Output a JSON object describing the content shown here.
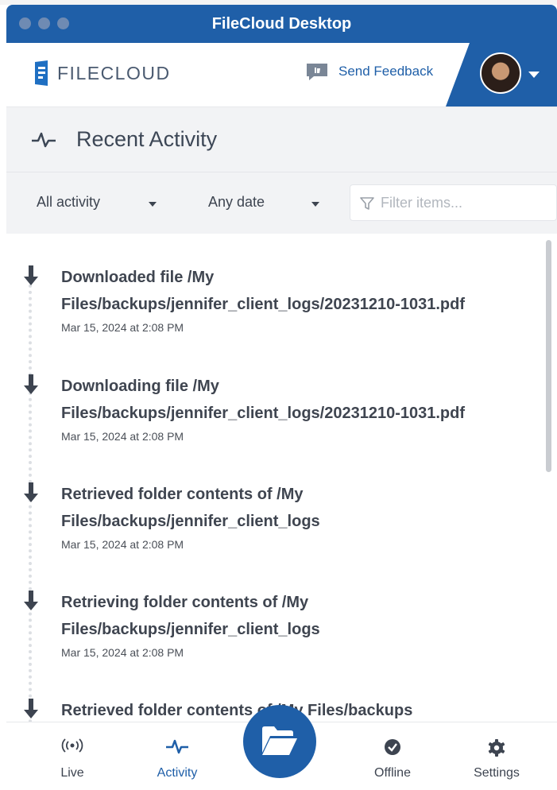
{
  "window": {
    "title": "FileCloud Desktop"
  },
  "header": {
    "logo_text": "FILECLOUD",
    "feedback_label": "Send Feedback",
    "brand_color": "#1f5fa8"
  },
  "page": {
    "title": "Recent Activity"
  },
  "filters": {
    "activity_filter": "All activity",
    "date_filter": "Any date",
    "search_placeholder": "Filter items..."
  },
  "activities": [
    {
      "line1": "Downloaded file /My",
      "line2": "Files/backups/jennifer_client_logs/20231210-1031.pdf",
      "time": "Mar 15, 2024 at 2:08 PM"
    },
    {
      "line1": "Downloading file /My",
      "line2": "Files/backups/jennifer_client_logs/20231210-1031.pdf",
      "time": "Mar 15, 2024 at 2:08 PM"
    },
    {
      "line1": "Retrieved folder contents of /My",
      "line2": "Files/backups/jennifer_client_logs",
      "time": "Mar 15, 2024 at 2:08 PM"
    },
    {
      "line1": "Retrieving folder contents of /My",
      "line2": "Files/backups/jennifer_client_logs",
      "time": "Mar 15, 2024 at 2:08 PM"
    },
    {
      "line1": "Retrieved folder contents of /My Files/backups",
      "line2": "",
      "time": ""
    }
  ],
  "nav": {
    "items": [
      {
        "label": "Live",
        "icon": "broadcast-icon"
      },
      {
        "label": "Activity",
        "icon": "activity-pulse-icon"
      },
      {
        "label": "Offline",
        "icon": "check-circle-icon"
      },
      {
        "label": "Settings",
        "icon": "gear-icon"
      }
    ],
    "active": "Activity",
    "fab_icon": "folder-open-icon"
  }
}
